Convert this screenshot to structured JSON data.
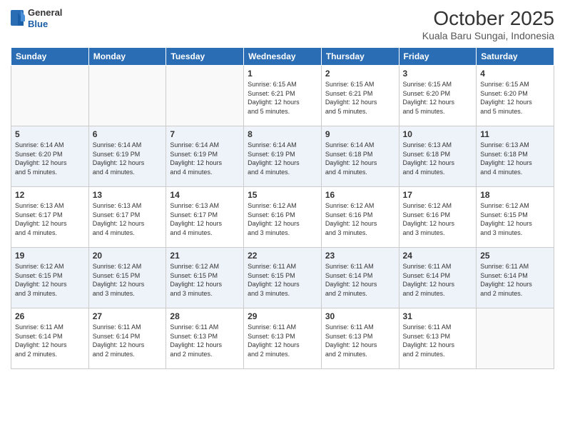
{
  "header": {
    "logo_general": "General",
    "logo_blue": "Blue",
    "month": "October 2025",
    "location": "Kuala Baru Sungai, Indonesia"
  },
  "days_of_week": [
    "Sunday",
    "Monday",
    "Tuesday",
    "Wednesday",
    "Thursday",
    "Friday",
    "Saturday"
  ],
  "weeks": [
    [
      {
        "day": "",
        "info": ""
      },
      {
        "day": "",
        "info": ""
      },
      {
        "day": "",
        "info": ""
      },
      {
        "day": "1",
        "info": "Sunrise: 6:15 AM\nSunset: 6:21 PM\nDaylight: 12 hours\nand 5 minutes."
      },
      {
        "day": "2",
        "info": "Sunrise: 6:15 AM\nSunset: 6:21 PM\nDaylight: 12 hours\nand 5 minutes."
      },
      {
        "day": "3",
        "info": "Sunrise: 6:15 AM\nSunset: 6:20 PM\nDaylight: 12 hours\nand 5 minutes."
      },
      {
        "day": "4",
        "info": "Sunrise: 6:15 AM\nSunset: 6:20 PM\nDaylight: 12 hours\nand 5 minutes."
      }
    ],
    [
      {
        "day": "5",
        "info": "Sunrise: 6:14 AM\nSunset: 6:20 PM\nDaylight: 12 hours\nand 5 minutes."
      },
      {
        "day": "6",
        "info": "Sunrise: 6:14 AM\nSunset: 6:19 PM\nDaylight: 12 hours\nand 4 minutes."
      },
      {
        "day": "7",
        "info": "Sunrise: 6:14 AM\nSunset: 6:19 PM\nDaylight: 12 hours\nand 4 minutes."
      },
      {
        "day": "8",
        "info": "Sunrise: 6:14 AM\nSunset: 6:19 PM\nDaylight: 12 hours\nand 4 minutes."
      },
      {
        "day": "9",
        "info": "Sunrise: 6:14 AM\nSunset: 6:18 PM\nDaylight: 12 hours\nand 4 minutes."
      },
      {
        "day": "10",
        "info": "Sunrise: 6:13 AM\nSunset: 6:18 PM\nDaylight: 12 hours\nand 4 minutes."
      },
      {
        "day": "11",
        "info": "Sunrise: 6:13 AM\nSunset: 6:18 PM\nDaylight: 12 hours\nand 4 minutes."
      }
    ],
    [
      {
        "day": "12",
        "info": "Sunrise: 6:13 AM\nSunset: 6:17 PM\nDaylight: 12 hours\nand 4 minutes."
      },
      {
        "day": "13",
        "info": "Sunrise: 6:13 AM\nSunset: 6:17 PM\nDaylight: 12 hours\nand 4 minutes."
      },
      {
        "day": "14",
        "info": "Sunrise: 6:13 AM\nSunset: 6:17 PM\nDaylight: 12 hours\nand 4 minutes."
      },
      {
        "day": "15",
        "info": "Sunrise: 6:12 AM\nSunset: 6:16 PM\nDaylight: 12 hours\nand 3 minutes."
      },
      {
        "day": "16",
        "info": "Sunrise: 6:12 AM\nSunset: 6:16 PM\nDaylight: 12 hours\nand 3 minutes."
      },
      {
        "day": "17",
        "info": "Sunrise: 6:12 AM\nSunset: 6:16 PM\nDaylight: 12 hours\nand 3 minutes."
      },
      {
        "day": "18",
        "info": "Sunrise: 6:12 AM\nSunset: 6:15 PM\nDaylight: 12 hours\nand 3 minutes."
      }
    ],
    [
      {
        "day": "19",
        "info": "Sunrise: 6:12 AM\nSunset: 6:15 PM\nDaylight: 12 hours\nand 3 minutes."
      },
      {
        "day": "20",
        "info": "Sunrise: 6:12 AM\nSunset: 6:15 PM\nDaylight: 12 hours\nand 3 minutes."
      },
      {
        "day": "21",
        "info": "Sunrise: 6:12 AM\nSunset: 6:15 PM\nDaylight: 12 hours\nand 3 minutes."
      },
      {
        "day": "22",
        "info": "Sunrise: 6:11 AM\nSunset: 6:15 PM\nDaylight: 12 hours\nand 3 minutes."
      },
      {
        "day": "23",
        "info": "Sunrise: 6:11 AM\nSunset: 6:14 PM\nDaylight: 12 hours\nand 2 minutes."
      },
      {
        "day": "24",
        "info": "Sunrise: 6:11 AM\nSunset: 6:14 PM\nDaylight: 12 hours\nand 2 minutes."
      },
      {
        "day": "25",
        "info": "Sunrise: 6:11 AM\nSunset: 6:14 PM\nDaylight: 12 hours\nand 2 minutes."
      }
    ],
    [
      {
        "day": "26",
        "info": "Sunrise: 6:11 AM\nSunset: 6:14 PM\nDaylight: 12 hours\nand 2 minutes."
      },
      {
        "day": "27",
        "info": "Sunrise: 6:11 AM\nSunset: 6:14 PM\nDaylight: 12 hours\nand 2 minutes."
      },
      {
        "day": "28",
        "info": "Sunrise: 6:11 AM\nSunset: 6:13 PM\nDaylight: 12 hours\nand 2 minutes."
      },
      {
        "day": "29",
        "info": "Sunrise: 6:11 AM\nSunset: 6:13 PM\nDaylight: 12 hours\nand 2 minutes."
      },
      {
        "day": "30",
        "info": "Sunrise: 6:11 AM\nSunset: 6:13 PM\nDaylight: 12 hours\nand 2 minutes."
      },
      {
        "day": "31",
        "info": "Sunrise: 6:11 AM\nSunset: 6:13 PM\nDaylight: 12 hours\nand 2 minutes."
      },
      {
        "day": "",
        "info": ""
      }
    ]
  ]
}
